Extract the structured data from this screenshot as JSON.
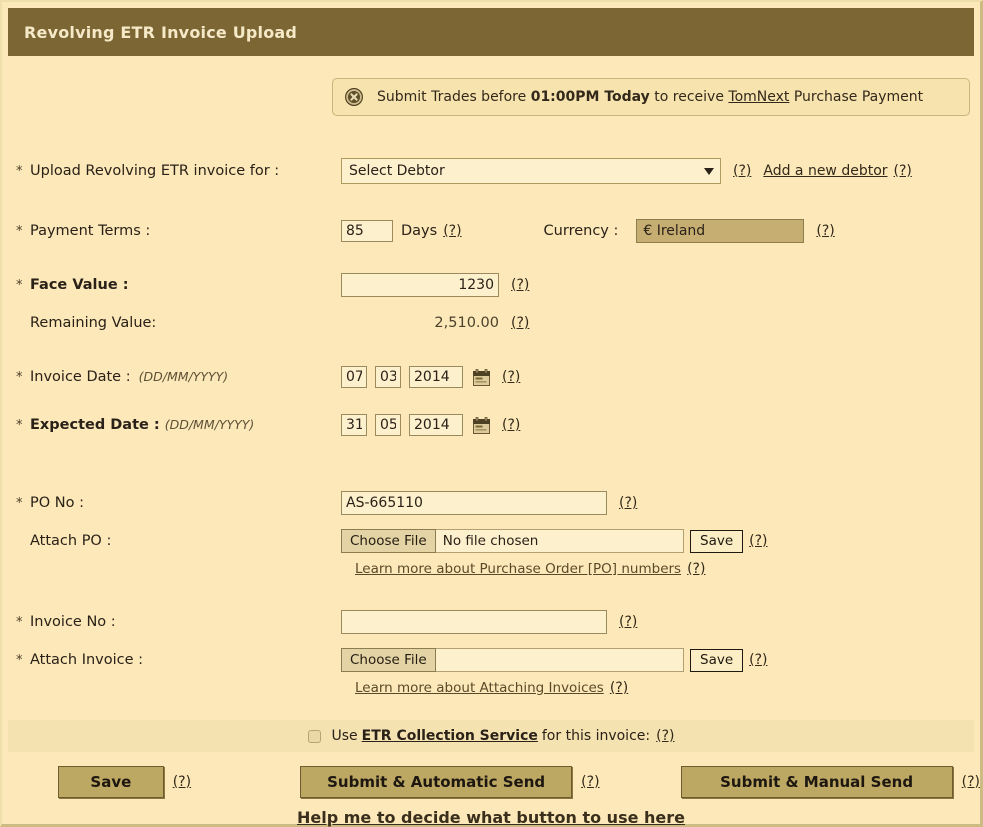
{
  "window": {
    "title": "Revolving ETR Invoice Upload"
  },
  "notice": {
    "icon": "error-circle-x-icon",
    "text_before": "Submit Trades before ",
    "deadline": "01:00PM Today",
    "text_middle": " to receive ",
    "link": "TomNext",
    "text_after": " Purchase Payment"
  },
  "help_marker": "(?)",
  "required_marker": "*",
  "form": {
    "debtor": {
      "label": "Upload Revolving ETR invoice for :",
      "selected": "Select Debtor",
      "add_link": "Add a new debtor"
    },
    "payment_terms": {
      "label": "Payment Terms :",
      "value": "85",
      "unit": "Days"
    },
    "currency": {
      "label": "Currency :",
      "value": "€ Ireland"
    },
    "face_value": {
      "label": "Face Value :",
      "value": "1230"
    },
    "remaining_value": {
      "label": "Remaining Value:",
      "value": "2,510.00"
    },
    "invoice_date": {
      "label": "Invoice Date :",
      "format": "(DD/MM/YYYY)",
      "day": "07",
      "month": "03",
      "year": "2014",
      "calendar_icon": "calendar-icon"
    },
    "expected_date": {
      "label": "Expected Date :",
      "format": "(DD/MM/YYYY)",
      "day": "31",
      "month": "05",
      "year": "2014",
      "calendar_icon": "calendar-icon"
    },
    "po_no": {
      "label": "PO No :",
      "value": "AS-665110",
      "placeholder": ""
    },
    "attach_po": {
      "label": "Attach PO :",
      "choose_label": "Choose File",
      "file_name": "No file chosen",
      "save_label": "Save",
      "learn_link": "Learn more about Purchase Order [PO] numbers"
    },
    "invoice_no": {
      "label": "Invoice No :",
      "value": "",
      "placeholder": ""
    },
    "attach_invoice": {
      "label": "Attach Invoice :",
      "choose_label": "Choose File",
      "file_name": "",
      "save_label": "Save",
      "learn_link": "Learn more about Attaching Invoices"
    }
  },
  "footer": {
    "collection": {
      "checked": false,
      "text_before": "Use ",
      "link": "ETR Collection Service",
      "text_after": " for this invoice:"
    },
    "buttons": {
      "save": "Save",
      "automatic": "Submit & Automatic Send",
      "manual": "Submit & Manual Send"
    },
    "help_link": "Help me to decide what button to use here"
  },
  "colors": {
    "page_bg": "#fce8b8",
    "title_bar": "#7c6633",
    "title_text": "#f5e9c8",
    "button_face": "#bda863",
    "disabled_field": "#c6ae73",
    "input_bg": "#fdf0cd"
  }
}
